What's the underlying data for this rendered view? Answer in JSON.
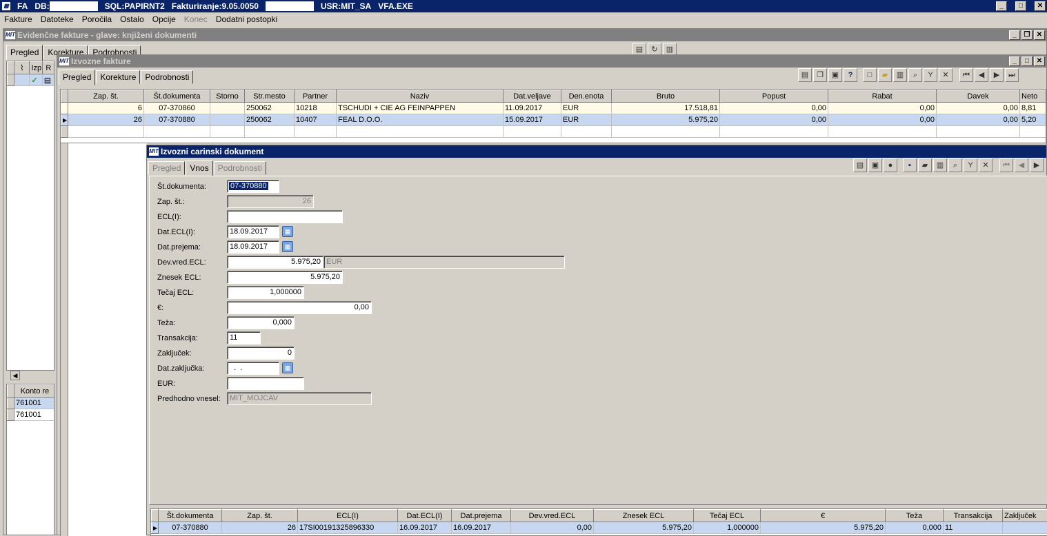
{
  "app": {
    "title_app": "FA",
    "title_db": "DB:",
    "title_sql": "SQL:PAPIRNT2",
    "title_ver": "Fakturiranje:9.05.0050",
    "title_usr": "USR:MIT_SA",
    "title_exe": "VFA.EXE"
  },
  "menu": [
    "Fakture",
    "Datoteke",
    "Poročila",
    "Ostalo",
    "Opcije",
    "Konec",
    "Dodatni postopki"
  ],
  "win1": {
    "title": "Evidenčne fakture - glave: knjiženi dokumenti",
    "tabs": [
      "Pregled",
      "Korekture",
      "Podrobnosti"
    ],
    "grid_headers": [
      "Izp",
      "R"
    ],
    "konto_header": "Konto re",
    "konto_rows": [
      "761001",
      "761001"
    ]
  },
  "win2": {
    "title": "Izvozne fakture",
    "tabs": [
      "Pregled",
      "Korekture",
      "Podrobnosti"
    ],
    "headers": [
      "Zap. št.",
      "Št.dokumenta",
      "Storno",
      "Str.mesto",
      "Partner",
      "Naziv",
      "Dat.veljave",
      "Den.enota",
      "Bruto",
      "Popust",
      "Rabat",
      "Davek",
      "Neto"
    ],
    "rows": [
      [
        "6",
        "07-370860",
        "",
        "250062",
        "10218",
        "TSCHUDI + CIE AG FEINPAPPEN",
        "11.09.2017",
        "EUR",
        "17.518,81",
        "0,00",
        "0,00",
        "0,00",
        "8,81"
      ],
      [
        "26",
        "07-370880",
        "",
        "250062",
        "10407",
        "FEAL D.O.O.",
        "15.09.2017",
        "EUR",
        "5.975,20",
        "0,00",
        "0,00",
        "0,00",
        "5,20"
      ]
    ]
  },
  "win3": {
    "title": "Izvozni carinski dokument",
    "tabs": [
      "Pregled",
      "Vnos",
      "Podrobnosti"
    ],
    "form": {
      "st_dokumenta_label": "Št.dokumenta:",
      "st_dokumenta": "07-370880",
      "zap_st_label": "Zap. št.:",
      "zap_st": "26",
      "ecl_label": "ECL(I):",
      "ecl": "",
      "dat_ecl_label": "Dat.ECL(I):",
      "dat_ecl": "18.09.2017",
      "dat_prejema_label": "Dat.prejema:",
      "dat_prejema": "18.09.2017",
      "dev_vred_label": "Dev.vred.ECL:",
      "dev_vred": "5.975,20",
      "dev_vred_cur": "EUR",
      "znesek_label": "Znesek ECL:",
      "znesek": "5.975,20",
      "tecaj_label": "Tečaj ECL:",
      "tecaj": "1,000000",
      "eur_sign_label": "€:",
      "eur_sign": "0,00",
      "teza_label": "Teža:",
      "teza": "0,000",
      "transakcija_label": "Transakcija:",
      "transakcija": "11",
      "zakljucek_label": "Zaključek:",
      "zakljucek": "0",
      "dat_zakljucka_label": "Dat.zaključka:",
      "dat_zakljucka": "  .  .",
      "eur_label": "EUR:",
      "eur": "",
      "predhodno_label": "Predhodno vnesel:",
      "predhodno": "MIT_MOJCAV"
    },
    "headers": [
      "Št.dokumenta",
      "Zap. št.",
      "ECL(I)",
      "Dat.ECL(I)",
      "Dat.prejema",
      "Dev.vred.ECL",
      "Znesek ECL",
      "Tečaj ECL",
      "€",
      "Teža",
      "Transakcija",
      "Zaključek"
    ],
    "rows": [
      [
        "07-370880",
        "26",
        "17SI00191325896330",
        "16.09.2017",
        "16.09.2017",
        "0,00",
        "5.975,20",
        "1,000000",
        "5.975,20",
        "0,000",
        "11",
        ""
      ]
    ]
  }
}
